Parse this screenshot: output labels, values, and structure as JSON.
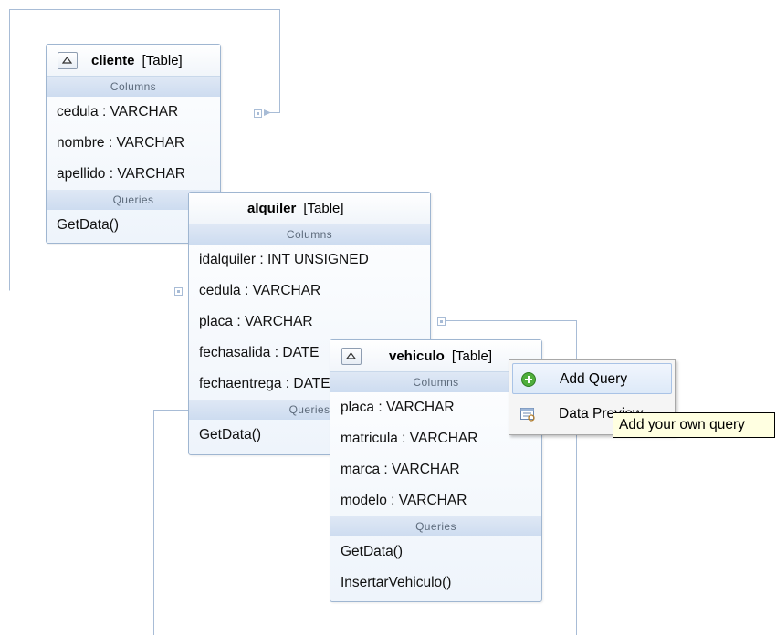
{
  "tables": {
    "cliente": {
      "name": "cliente",
      "kind": "[Table]",
      "columns_label": "Columns",
      "columns": [
        "cedula : VARCHAR",
        "nombre : VARCHAR",
        "apellido : VARCHAR"
      ],
      "queries_label": "Queries",
      "queries": [
        "GetData()"
      ]
    },
    "alquiler": {
      "name": "alquiler",
      "kind": "[Table]",
      "columns_label": "Columns",
      "columns": [
        "idalquiler : INT UNSIGNED",
        "cedula : VARCHAR",
        "placa : VARCHAR",
        "fechasalida : DATE",
        "fechaentrega : DATE"
      ],
      "queries_label": "Queries",
      "queries": [
        "GetData()"
      ]
    },
    "vehiculo": {
      "name": "vehiculo",
      "kind": "[Table]",
      "columns_label": "Columns",
      "columns": [
        "placa : VARCHAR",
        "matricula : VARCHAR",
        "marca : VARCHAR",
        "modelo : VARCHAR"
      ],
      "queries_label": "Queries",
      "queries": [
        "GetData()",
        "InsertarVehiculo()"
      ]
    }
  },
  "context_menu": {
    "items": [
      {
        "label": "Add Query",
        "icon": "add-query-icon"
      },
      {
        "label": "Data Preview",
        "icon": "data-preview-icon"
      }
    ]
  },
  "tooltip": "Add your own query",
  "colors": {
    "border": "#9fb6d1",
    "section_bg": "#cddcf0",
    "relation_line": "#a8bcd6",
    "tooltip_bg": "#ffffe1"
  }
}
